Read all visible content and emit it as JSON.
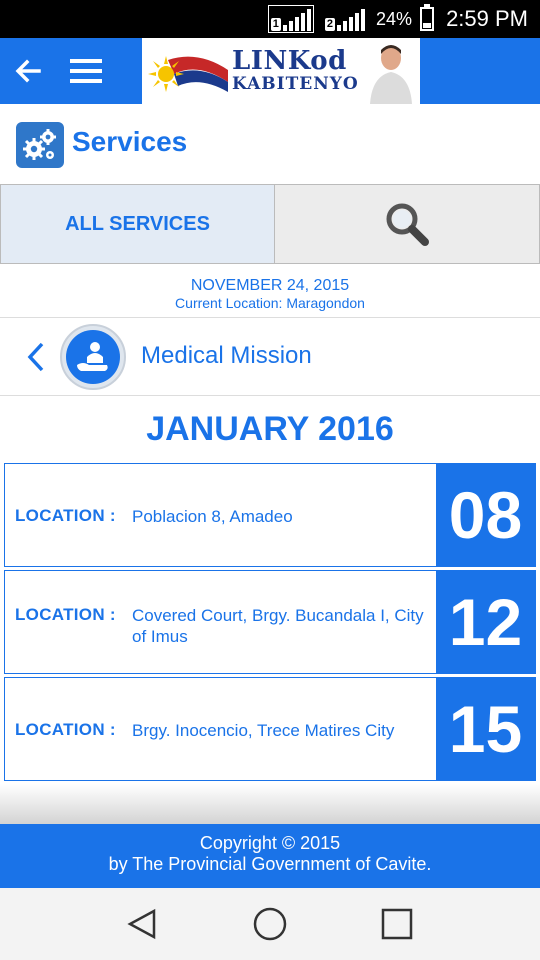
{
  "status_bar": {
    "sim1": "1",
    "sim2": "2",
    "battery": "24%",
    "time": "2:59 PM"
  },
  "app_bar": {
    "back_icon": "arrow-left-icon",
    "menu_icon": "hamburger-menu-icon",
    "logo_line1": "LINKod",
    "logo_line2": "KABITENYO"
  },
  "page": {
    "title": "Services",
    "title_icon": "gears-icon"
  },
  "tabs": {
    "all_services": "ALL SERVICES",
    "search_icon": "magnifier-icon"
  },
  "info": {
    "date": "NOVEMBER 24, 2015",
    "location": "Current Location: Maragondon"
  },
  "category": {
    "label": "Medical Mission",
    "icon": "medical-mission-icon"
  },
  "month": "JANUARY 2016",
  "events": [
    {
      "label": "LOCATION :",
      "location": "Poblacion 8, Amadeo",
      "day": "08"
    },
    {
      "label": "LOCATION :",
      "location": "Covered Court, Brgy. Bucandala I, City of Imus",
      "day": "12"
    },
    {
      "label": "LOCATION :",
      "location": "Brgy. Inocencio, Trece Matires City",
      "day": "15"
    }
  ],
  "footer": {
    "line1": "Copyright © 2015",
    "line2": "by The Provincial Government of Cavite."
  },
  "colors": {
    "accent": "#1a73e8",
    "tab_bg": "#e3ebf5"
  }
}
